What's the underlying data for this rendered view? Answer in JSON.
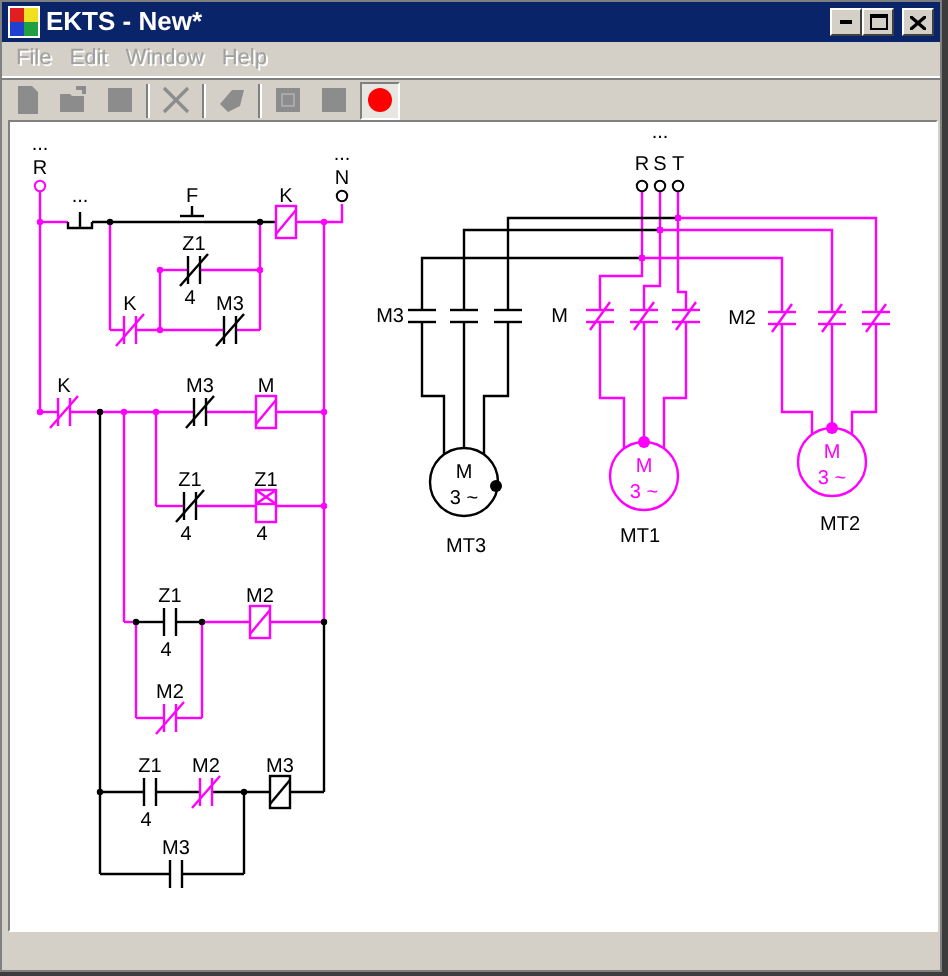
{
  "window": {
    "title": "EKTS - New*"
  },
  "menu": [
    {
      "label": "File",
      "disabled": true
    },
    {
      "label": "Edit",
      "disabled": true
    },
    {
      "label": "Window",
      "disabled": true
    },
    {
      "label": "Help",
      "disabled": true
    }
  ],
  "toolbar": [
    {
      "kind": "new",
      "disabled": true,
      "pressed": false
    },
    {
      "kind": "open",
      "disabled": true,
      "pressed": false
    },
    {
      "kind": "save",
      "disabled": true,
      "pressed": false
    },
    {
      "kind": "separator"
    },
    {
      "kind": "delete",
      "disabled": true,
      "pressed": false
    },
    {
      "kind": "separator"
    },
    {
      "kind": "erase",
      "disabled": true,
      "pressed": false
    },
    {
      "kind": "separator"
    },
    {
      "kind": "grid",
      "disabled": true,
      "pressed": false
    },
    {
      "kind": "stop",
      "disabled": true,
      "pressed": false
    },
    {
      "kind": "record",
      "disabled": false,
      "pressed": true
    }
  ],
  "control_circuit": {
    "elements": [
      {
        "kind": "terminal",
        "label": "R",
        "note": "...",
        "energized": true
      },
      {
        "kind": "pushbutton_nc",
        "label": "...",
        "energized": false
      },
      {
        "kind": "pushbutton_no",
        "label": "F",
        "energized": false
      },
      {
        "kind": "coil",
        "label": "K",
        "energized": true
      },
      {
        "kind": "terminal",
        "label": "N",
        "note": "...",
        "energized": false
      },
      {
        "kind": "nc_contact",
        "label": "K",
        "energized": true
      },
      {
        "kind": "nc_contact",
        "label": "Z1",
        "value": "4",
        "energized": false
      },
      {
        "kind": "nc_contact",
        "label": "M3",
        "energized": false
      },
      {
        "kind": "nc_contact",
        "label": "K",
        "energized": true
      },
      {
        "kind": "nc_contact",
        "label": "M3",
        "energized": false
      },
      {
        "kind": "coil",
        "label": "M",
        "energized": true
      },
      {
        "kind": "nc_contact",
        "label": "Z1",
        "value": "4",
        "energized": false
      },
      {
        "kind": "timer_coil",
        "label": "Z1",
        "value": "4",
        "energized": true
      },
      {
        "kind": "no_contact",
        "label": "Z1",
        "value": "4",
        "energized": false
      },
      {
        "kind": "coil",
        "label": "M2",
        "energized": true
      },
      {
        "kind": "nc_contact",
        "label": "M2",
        "energized": true
      },
      {
        "kind": "no_contact",
        "label": "Z1",
        "value": "4",
        "energized": false
      },
      {
        "kind": "nc_contact",
        "label": "M2",
        "energized": true
      },
      {
        "kind": "coil",
        "label": "M3",
        "energized": false
      },
      {
        "kind": "no_contact",
        "label": "M3",
        "energized": false
      }
    ]
  },
  "power_circuit": {
    "supply": {
      "note": "...",
      "phases": [
        "R",
        "S",
        "T"
      ]
    },
    "branches": [
      {
        "contactor": "M3",
        "motor": "MT3",
        "motor_symbol": "M",
        "motor_phases": "3 ~",
        "energized": false
      },
      {
        "contactor": "M",
        "motor": "MT1",
        "motor_symbol": "M",
        "motor_phases": "3 ~",
        "energized": true
      },
      {
        "contactor": "M2",
        "motor": "MT2",
        "motor_symbol": "M",
        "motor_phases": "3 ~",
        "energized": true
      }
    ]
  }
}
